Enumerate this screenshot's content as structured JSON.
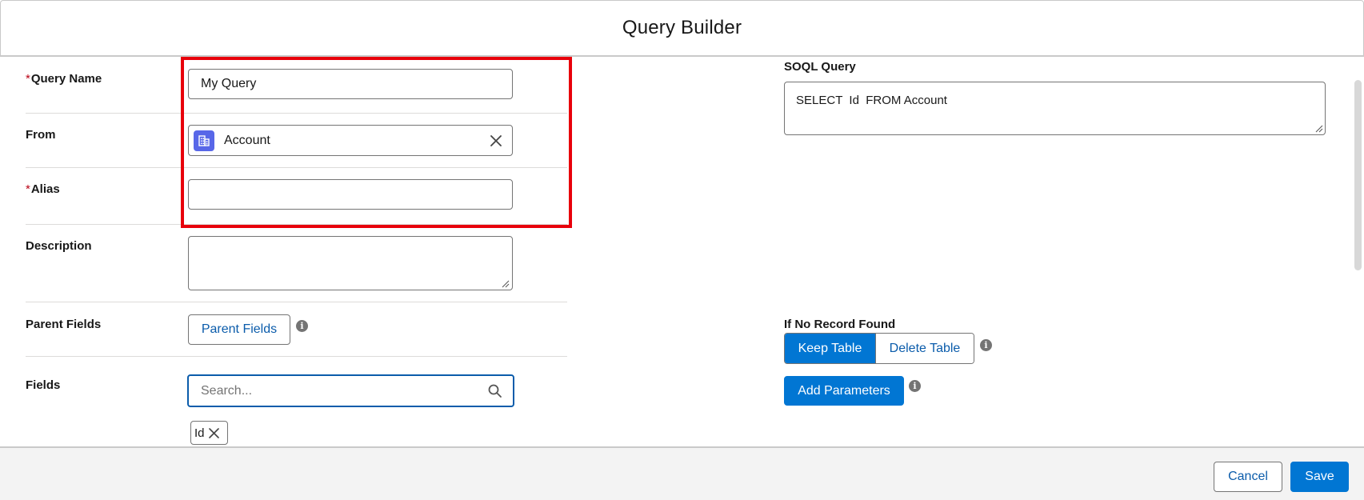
{
  "modal": {
    "title": "Query Builder"
  },
  "form": {
    "required_marker": "*",
    "query_name": {
      "label": "Query Name",
      "value": "My Query"
    },
    "from": {
      "label": "From",
      "value": "Account",
      "object_icon": "account-building-icon"
    },
    "alias": {
      "label": "Alias",
      "value": ""
    },
    "description": {
      "label": "Description",
      "value": ""
    },
    "parent_fields": {
      "label": "Parent Fields",
      "button_label": "Parent Fields"
    },
    "fields": {
      "label": "Fields",
      "search_placeholder": "Search...",
      "selected": [
        "Id"
      ]
    }
  },
  "soql": {
    "label": "SOQL Query",
    "value": "SELECT  Id  FROM Account"
  },
  "no_record": {
    "label": "If No Record Found",
    "options": [
      "Keep Table",
      "Delete Table"
    ],
    "selected": "Keep Table"
  },
  "add_parameters": {
    "label": "Add Parameters"
  },
  "info_glyph": "i",
  "footer": {
    "cancel_label": "Cancel",
    "save_label": "Save"
  },
  "colors": {
    "brand": "#0176d3",
    "brand_text": "#0b5cab",
    "required": "#ba0517",
    "highlight": "#e8000b",
    "object_icon_bg": "#5867e8"
  }
}
